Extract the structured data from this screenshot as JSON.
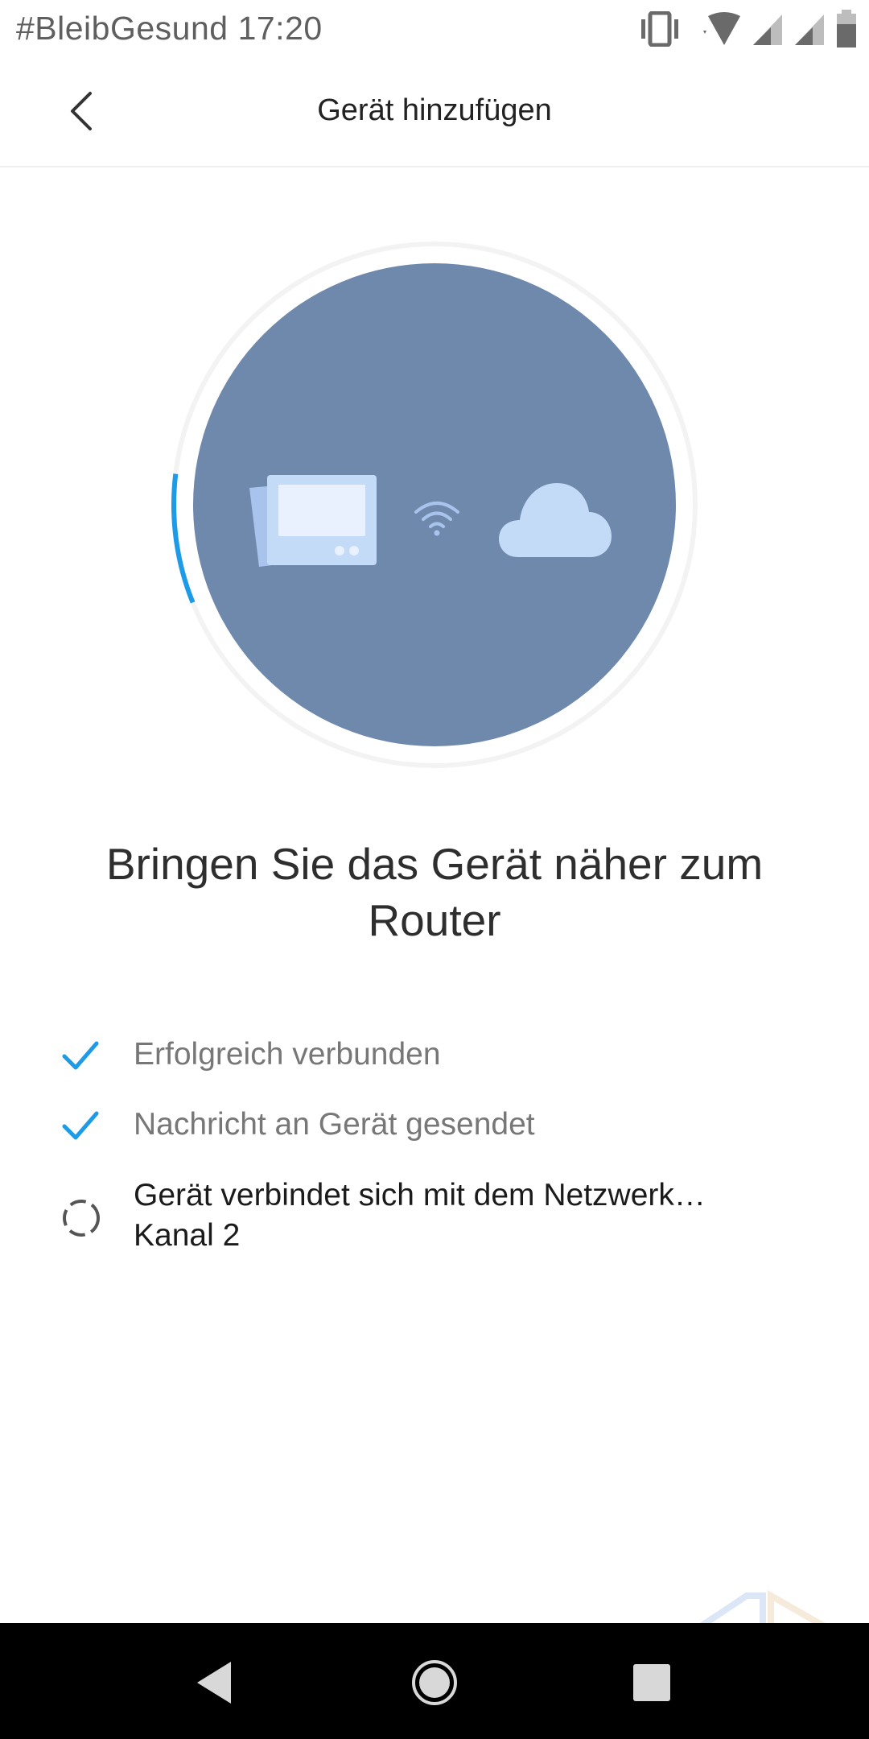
{
  "status_bar": {
    "carrier_text": "#BleibGesund",
    "time": "17:20",
    "icons": [
      "vibrate-icon",
      "wifi-signal-icon",
      "cell-signal-icon",
      "cell-signal-icon",
      "battery-icon"
    ]
  },
  "header": {
    "title": "Gerät hinzufügen",
    "back_icon": "chevron-left-icon"
  },
  "illustration": {
    "progress_fraction": 0.08,
    "icons": [
      "thermostat-device-icon",
      "wifi-icon",
      "cloud-icon"
    ],
    "colors": {
      "circle": "#6f89ad",
      "progress": "#1e9be8",
      "icon_fill": "#c7ddf8"
    }
  },
  "main": {
    "headline": "Bringen Sie das Gerät näher zum Router"
  },
  "steps": [
    {
      "status": "done",
      "icon": "check-icon",
      "label": "Erfolgreich verbunden"
    },
    {
      "status": "done",
      "icon": "check-icon",
      "label": "Nachricht an Gerät gesendet"
    },
    {
      "status": "in-progress",
      "icon": "spinner-icon",
      "label": "Gerät verbindet sich mit dem Netzwerk…",
      "sublabel": "Kanal 2"
    }
  ],
  "nav_bar": {
    "buttons": [
      "back-triangle-icon",
      "home-circle-icon",
      "recents-square-icon"
    ]
  }
}
